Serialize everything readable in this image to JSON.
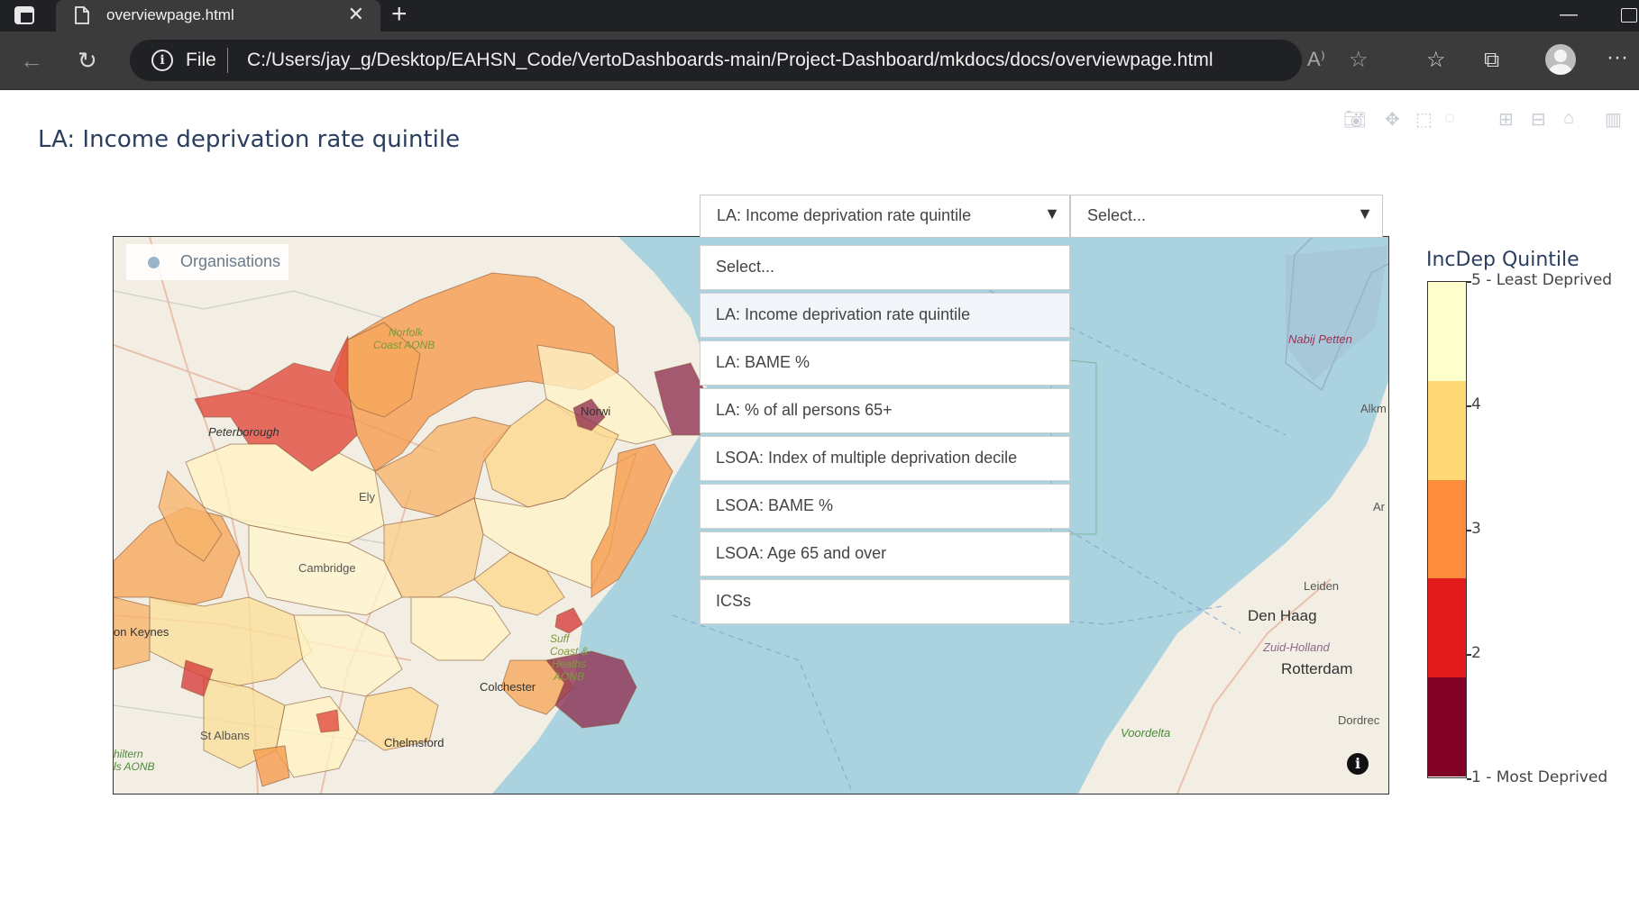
{
  "browser": {
    "tab_title": "overviewpage.html",
    "address_prefix": "File",
    "url": "C:/Users/jay_g/Desktop/EAHSN_Code/VertoDashboards-main/Project-Dashboard/mkdocs/docs/overviewpage.html"
  },
  "page": {
    "title": "LA: Income deprivation rate quintile"
  },
  "dropdowns": {
    "metric": {
      "value": "LA: Income deprivation rate quintile",
      "arrow": "▼"
    },
    "secondary": {
      "value": "Select...",
      "arrow": "▼"
    },
    "options": [
      "Select...",
      "LA: Income deprivation rate quintile",
      "LA: BAME %",
      "LA: % of all persons 65+",
      "LSOA: Index of multiple deprivation decile",
      "LSOA: BAME %",
      "LSOA: Age 65 and over",
      "ICSs"
    ],
    "selected_index": 1
  },
  "map": {
    "legend_label": "Organisations",
    "info_glyph": "i",
    "labels": {
      "peterborough": "Peterborough",
      "norfolk_aonb_1": "Norfolk",
      "norfolk_aonb_2": "Coast AONB",
      "norwich": "Norwi",
      "ely": "Ely",
      "cambridge": "Cambridge",
      "milton_keynes": "on Keynes",
      "st_albans": "St Albans",
      "chelmsford": "Chelmsford",
      "colchester": "Colchester",
      "suffolk_1": "Suff",
      "suffolk_2": "Coast &",
      "suffolk_3": "Heaths",
      "suffolk_4": "AONB",
      "chiltern_1": "hiltern",
      "chiltern_2": "ls AONB",
      "den_haag": "Den Haag",
      "zuid_holland": "Zuid-Holland",
      "rotterdam": "Rotterdam",
      "leiden": "Leiden",
      "dordrecht": "Dordrec",
      "voordelta": "Voordelta",
      "nabij_petten": "Nabij Petten",
      "alkmaar": "Alkm",
      "ar": "Ar"
    }
  },
  "colorbar": {
    "title": "IncDep Quintile",
    "ticks": [
      {
        "label": "5 - Least Deprived",
        "value": 5
      },
      {
        "label": "4",
        "value": 4
      },
      {
        "label": "3",
        "value": 3
      },
      {
        "label": "2",
        "value": 2
      },
      {
        "label": "1 - Most Deprived",
        "value": 1
      }
    ],
    "colors": [
      "#ffffcc",
      "#fed976",
      "#fd8d3c",
      "#e31a1c",
      "#800026"
    ]
  }
}
